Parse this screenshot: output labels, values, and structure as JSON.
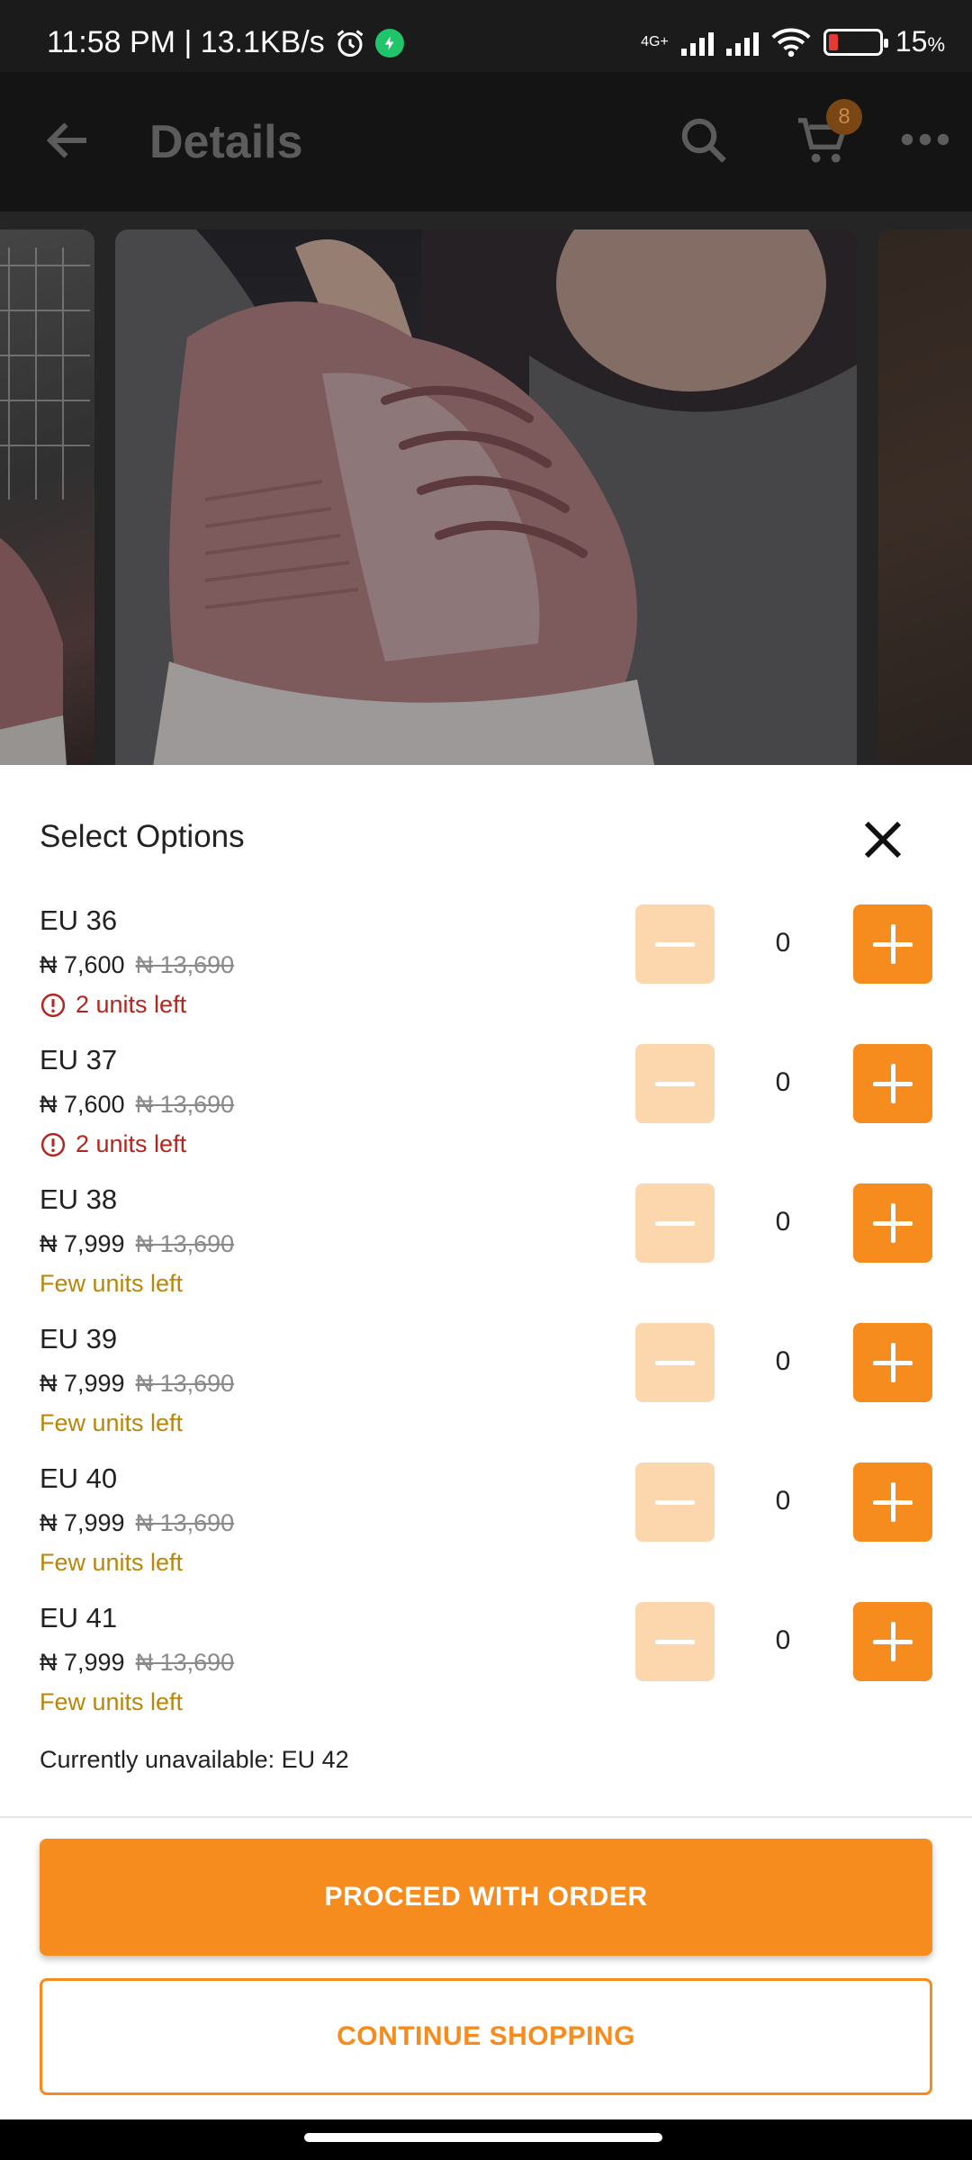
{
  "status_bar": {
    "time_speed": "11:58 PM | 13.1KB/s",
    "network": "4G+",
    "battery_percent": "15",
    "battery_unit": "%",
    "icons": [
      "alarm-icon",
      "app-notification-icon",
      "signal-icon",
      "wifi-icon",
      "battery-icon"
    ]
  },
  "app_bar": {
    "title": "Details",
    "cart_count": "8",
    "icons": [
      "back-arrow-icon",
      "search-icon",
      "cart-icon",
      "more-icon"
    ]
  },
  "sheet": {
    "title": "Select Options",
    "options": [
      {
        "size": "EU 36",
        "price": "₦ 7,600",
        "old_price": "₦ 13,690",
        "stock": "2 units left",
        "stock_level": "critical",
        "quantity": "0"
      },
      {
        "size": "EU 37",
        "price": "₦ 7,600",
        "old_price": "₦ 13,690",
        "stock": "2 units left",
        "stock_level": "critical",
        "quantity": "0"
      },
      {
        "size": "EU 38",
        "price": "₦ 7,999",
        "old_price": "₦ 13,690",
        "stock": "Few units left",
        "stock_level": "low",
        "quantity": "0"
      },
      {
        "size": "EU 39",
        "price": "₦ 7,999",
        "old_price": "₦ 13,690",
        "stock": "Few units left",
        "stock_level": "low",
        "quantity": "0"
      },
      {
        "size": "EU 40",
        "price": "₦ 7,999",
        "old_price": "₦ 13,690",
        "stock": "Few units left",
        "stock_level": "low",
        "quantity": "0"
      },
      {
        "size": "EU 41",
        "price": "₦ 7,999",
        "old_price": "₦ 13,690",
        "stock": "Few units left",
        "stock_level": "low",
        "quantity": "0"
      }
    ],
    "unavailable_text": "Currently unavailable: EU 42",
    "proceed_label": "PROCEED WITH ORDER",
    "continue_label": "CONTINUE SHOPPING"
  },
  "colors": {
    "accent": "#f68b1e",
    "accent_light": "#fcd6ad",
    "stock_critical": "#b3261e",
    "stock_low": "#b8860b"
  }
}
